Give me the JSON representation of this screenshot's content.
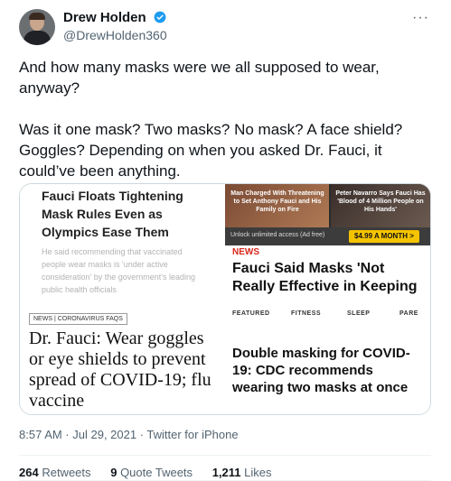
{
  "user": {
    "name": "Drew Holden",
    "handle": "@DrewHolden360",
    "verified_color": "#1d9bf0"
  },
  "more_label": "···",
  "tweet": {
    "text": "And how many masks were we all supposed to wear, anyway?\n\nWas it one mask? Two masks? No mask? A face shield? Goggles? Depending on when you asked Dr. Fauci, it could’ve been anything."
  },
  "media": {
    "panel1": {
      "headline": "Fauci Floats Tightening Mask Rules Even as Olympics Ease Them",
      "subtext": "He said recommending that vaccinated people wear masks is 'under active consideration' by the government's leading public health officials"
    },
    "panel2": {
      "badge": "NEWS | CORONAVIRUS FAQS",
      "headline": "Dr. Fauci: Wear goggles or eye shields to prevent spread of COVID-19; flu vaccine"
    },
    "panel3": {
      "caption1": "Man Charged With Threatening to Set Anthony Fauci and His Family on Fire",
      "caption2": "Peter Navarro Says Fauci Has 'Blood of 4 Million People on His Hands'"
    },
    "panel4": {
      "text": "Unlock unlimited access (Ad free)",
      "button": "$4.99 A MONTH >"
    },
    "panel5": {
      "tag": "NEWS",
      "headline": "Fauci Said Masks 'Not Really Effective in Keeping"
    },
    "panel6": {
      "nav": [
        "FEATURED",
        "FITNESS",
        "SLEEP",
        "PARE"
      ],
      "headline": "Double masking for COVID-19: CDC recommends wearing two masks at once"
    }
  },
  "meta": "8:57 AM · Jul 29, 2021 · Twitter for iPhone",
  "stats": {
    "retweets_count": "264",
    "retweets_label": "Retweets",
    "quotes_count": "9",
    "quotes_label": "Quote Tweets",
    "likes_count": "1,211",
    "likes_label": "Likes"
  }
}
